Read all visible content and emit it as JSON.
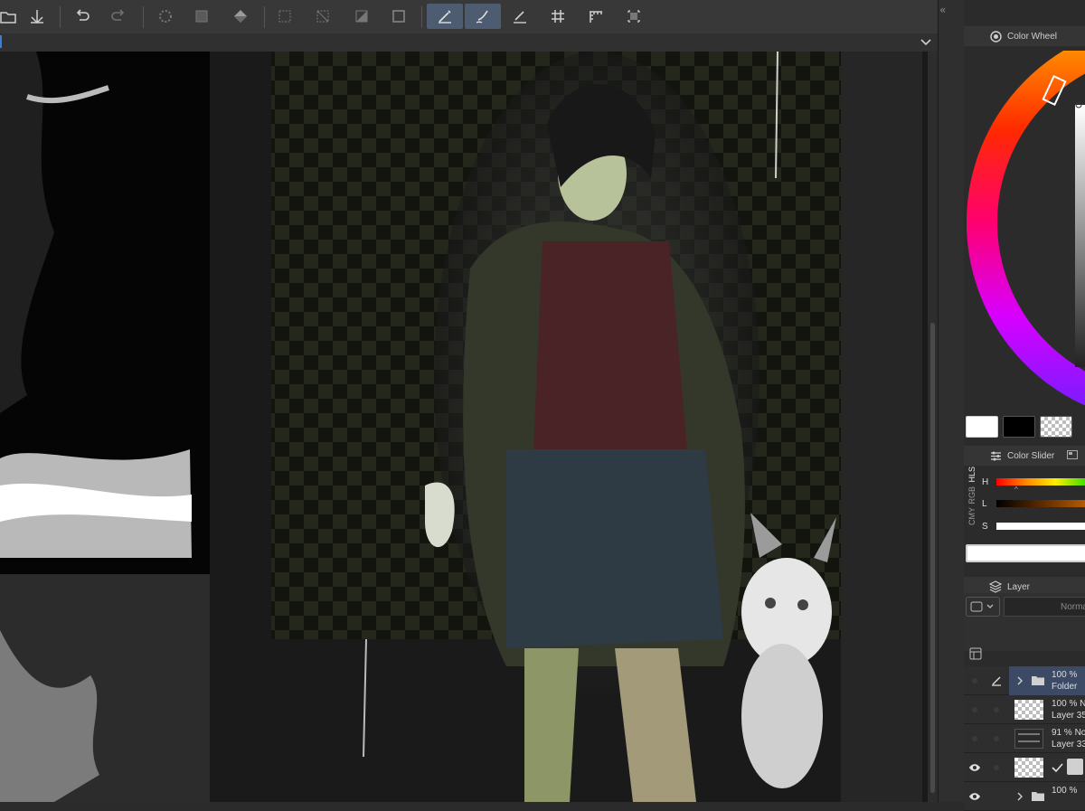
{
  "toolbar": {
    "buttons": [
      {
        "name": "open-file",
        "icon": "open-folder-icon"
      },
      {
        "name": "save",
        "icon": "save-icon"
      },
      {
        "name": "undo",
        "icon": "undo-icon"
      },
      {
        "name": "redo",
        "icon": "redo-icon"
      },
      {
        "name": "loading",
        "icon": "spinner-icon"
      },
      {
        "name": "transform",
        "icon": "transform-icon"
      },
      {
        "name": "fill",
        "icon": "fill-bucket-icon"
      },
      {
        "name": "selection-clear",
        "icon": "selection-icon"
      },
      {
        "name": "deselect",
        "icon": "deselect-icon"
      },
      {
        "name": "invert-selection",
        "icon": "invert-selection-icon"
      },
      {
        "name": "show-selection",
        "icon": "selection-border-icon"
      },
      {
        "name": "snap-ruler",
        "icon": "ruler-pen-icon"
      },
      {
        "name": "snap-special-ruler",
        "icon": "brush-ruler-icon"
      },
      {
        "name": "snap-grid",
        "icon": "pen-grid-icon"
      },
      {
        "name": "grid",
        "icon": "grid-icon"
      },
      {
        "name": "ruler",
        "icon": "ruler-icon"
      },
      {
        "name": "crop-marks",
        "icon": "crop-marks-icon"
      }
    ],
    "collapse_glyph": "«"
  },
  "colors": {
    "accent": "#4e5c72",
    "selection_blue": "#3c7dd8"
  },
  "panels": {
    "color_wheel": {
      "title": "Color Wheel",
      "icon": "color-wheel-icon"
    },
    "color_slider": {
      "title": "Color Slider",
      "tabs": [
        "HLS",
        "RGB",
        "CMY"
      ],
      "rows": [
        {
          "label": "H"
        },
        {
          "label": "L"
        },
        {
          "label": "S"
        }
      ]
    },
    "layer": {
      "title": "Layer",
      "blend_mode": "Norma",
      "rows": [
        {
          "line1": "100 %",
          "line2": "Folder",
          "type": "folder",
          "selected": true,
          "visible": false
        },
        {
          "line1": "100 % N",
          "line2": "Layer 35",
          "type": "layer",
          "selected": false,
          "visible": false
        },
        {
          "line1": "91 % No",
          "line2": "Layer 33",
          "type": "layer",
          "selected": false,
          "visible": false
        },
        {
          "line1": "",
          "line2": "",
          "type": "layer",
          "selected": false,
          "visible": true
        },
        {
          "line1": "100 %",
          "line2": "",
          "type": "folder",
          "selected": false,
          "visible": true
        }
      ]
    }
  }
}
